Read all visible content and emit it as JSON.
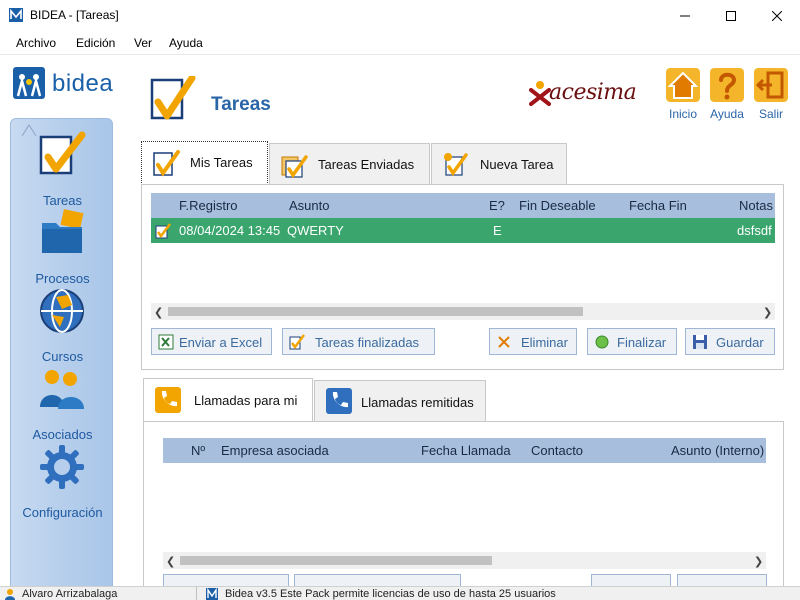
{
  "window": {
    "title": "BIDEA - [Tareas]"
  },
  "menu": [
    "Archivo",
    "Edición",
    "Ver",
    "Ayuda"
  ],
  "sidebar": {
    "logo": "bidea",
    "items": [
      {
        "label": "Tareas",
        "icon": "checkmark-icon"
      },
      {
        "label": "Procesos",
        "icon": "folder-icon"
      },
      {
        "label": "Cursos",
        "icon": "globe-icon"
      },
      {
        "label": "Asociados",
        "icon": "people-icon"
      },
      {
        "label": "Configuración",
        "icon": "gear-icon"
      }
    ]
  },
  "header": {
    "title": "Tareas",
    "brand": "acesima",
    "tools": [
      {
        "label": "Inicio",
        "icon": "home-icon"
      },
      {
        "label": "Ayuda",
        "icon": "help-icon"
      },
      {
        "label": "Salir",
        "icon": "exit-icon"
      }
    ]
  },
  "tasks_tabs": [
    "Mis Tareas",
    "Tareas Enviadas",
    "Nueva Tarea"
  ],
  "tasks_grid": {
    "columns": [
      "F.Registro",
      "Asunto",
      "E?",
      "Fin Deseable",
      "Fecha Fin",
      "Notas"
    ],
    "rows": [
      {
        "f_registro": "08/04/2024 13:45",
        "asunto": "QWERTY",
        "estado": "E",
        "fin_deseable": "",
        "fecha_fin": "",
        "notas": "dsfsdf"
      }
    ]
  },
  "tasks_buttons": {
    "excel": "Enviar a Excel",
    "finished": "Tareas finalizadas",
    "delete": "Eliminar",
    "finish": "Finalizar",
    "save": "Guardar"
  },
  "calls_tabs": [
    "Llamadas para mi",
    "Llamadas remitidas"
  ],
  "calls_grid": {
    "columns": [
      "Nº",
      "Empresa asociada",
      "Fecha Llamada",
      "Contacto",
      "Asunto (Interno)"
    ]
  },
  "status": {
    "user": "Alvaro Arrizabalaga",
    "message": "Bidea v3.5  Este Pack permite licencias de uso de hasta 25 usuarios"
  },
  "colors": {
    "accent": "#2a65a8",
    "selected_row": "#3aa66e",
    "grid_header": "#a7bfdc",
    "sidebar": "#b7cfec"
  }
}
